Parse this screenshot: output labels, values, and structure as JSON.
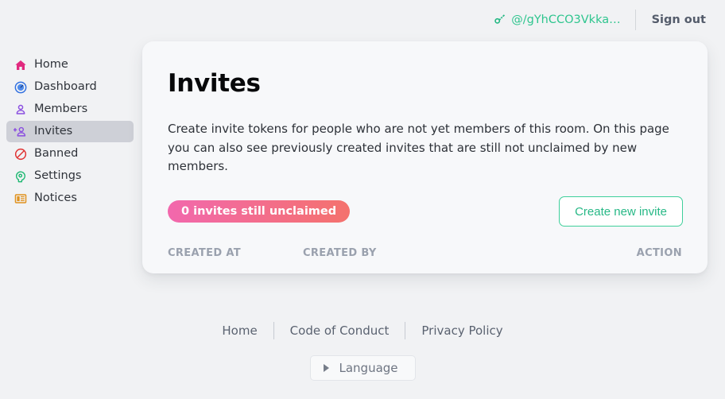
{
  "topbar": {
    "key_icon": "key-icon",
    "username": "@/gYhCCO3Vkka…",
    "signout_label": "Sign out"
  },
  "sidebar": {
    "items": [
      {
        "label": "Home",
        "icon": "house-icon",
        "color": "#e12a7f",
        "active": false
      },
      {
        "label": "Dashboard",
        "icon": "dashboard-icon",
        "color": "#2f6fe0",
        "active": false
      },
      {
        "label": "Members",
        "icon": "user-icon",
        "color": "#8a4ee0",
        "active": false
      },
      {
        "label": "Invites",
        "icon": "user-add-icon",
        "color": "#8a4ee0",
        "active": true
      },
      {
        "label": "Banned",
        "icon": "prohibition-icon",
        "color": "#e03232",
        "active": false
      },
      {
        "label": "Settings",
        "icon": "gear-head-icon",
        "color": "#1eb872",
        "active": false
      },
      {
        "label": "Notices",
        "icon": "notice-board-icon",
        "color": "#e0921e",
        "active": false
      }
    ]
  },
  "main": {
    "title": "Invites",
    "description": "Create invite tokens for people who are not yet members of this room. On this page you can also see previously created invites that are still not unclaimed by new members.",
    "badge": "0 invites still unclaimed",
    "create_button": "Create new invite",
    "table": {
      "columns": [
        "CREATED AT",
        "CREATED BY",
        "ACTION"
      ],
      "rows": []
    }
  },
  "footer": {
    "links": [
      "Home",
      "Code of Conduct",
      "Privacy Policy"
    ],
    "language_label": "Language"
  },
  "colors": {
    "accent_green": "#2ec58e",
    "badge_start": "#f268ad",
    "badge_end": "#f4726d",
    "page_bg": "#f1f2f4",
    "card_bg": "#f7f8fa",
    "active_nav_bg": "#ced0d7"
  }
}
